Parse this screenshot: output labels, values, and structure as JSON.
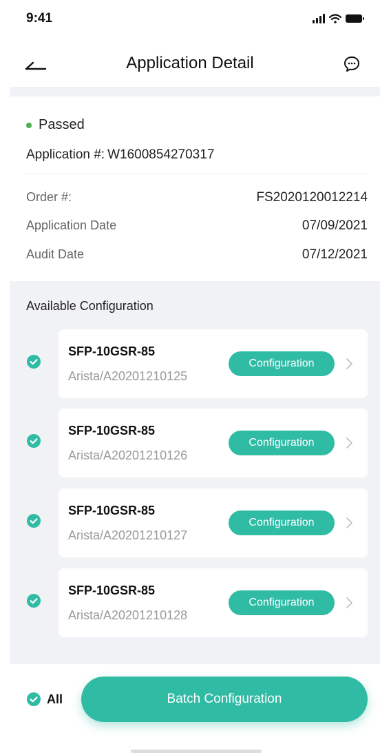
{
  "status_bar": {
    "time": "9:41"
  },
  "nav": {
    "title": "Application Detail"
  },
  "application": {
    "status": "Passed",
    "number_label": "Application #:",
    "number": "W1600854270317",
    "fields": [
      {
        "label": "Order #:",
        "value": "FS2020120012214"
      },
      {
        "label": "Application Date",
        "value": "07/09/2021"
      },
      {
        "label": "Audit Date",
        "value": "07/12/2021"
      }
    ]
  },
  "config": {
    "section_title": "Available Configuration",
    "items": [
      {
        "name": "SFP-10GSR-85",
        "sub": "Arista/A20201210125",
        "button": "Configuration"
      },
      {
        "name": "SFP-10GSR-85",
        "sub": "Arista/A20201210126",
        "button": "Configuration"
      },
      {
        "name": "SFP-10GSR-85",
        "sub": "Arista/A20201210127",
        "button": "Configuration"
      },
      {
        "name": "SFP-10GSR-85",
        "sub": "Arista/A20201210128",
        "button": "Configuration"
      }
    ]
  },
  "footer": {
    "all_label": "All",
    "batch_button": "Batch Configuration"
  },
  "colors": {
    "accent": "#30bba4",
    "status_green": "#4caf50",
    "panel_bg": "#f1f2f6"
  },
  "icons": {
    "back": "back-arrow-icon",
    "chat": "chat-icon",
    "check": "check-circle-icon",
    "chevron": "chevron-right-icon"
  }
}
